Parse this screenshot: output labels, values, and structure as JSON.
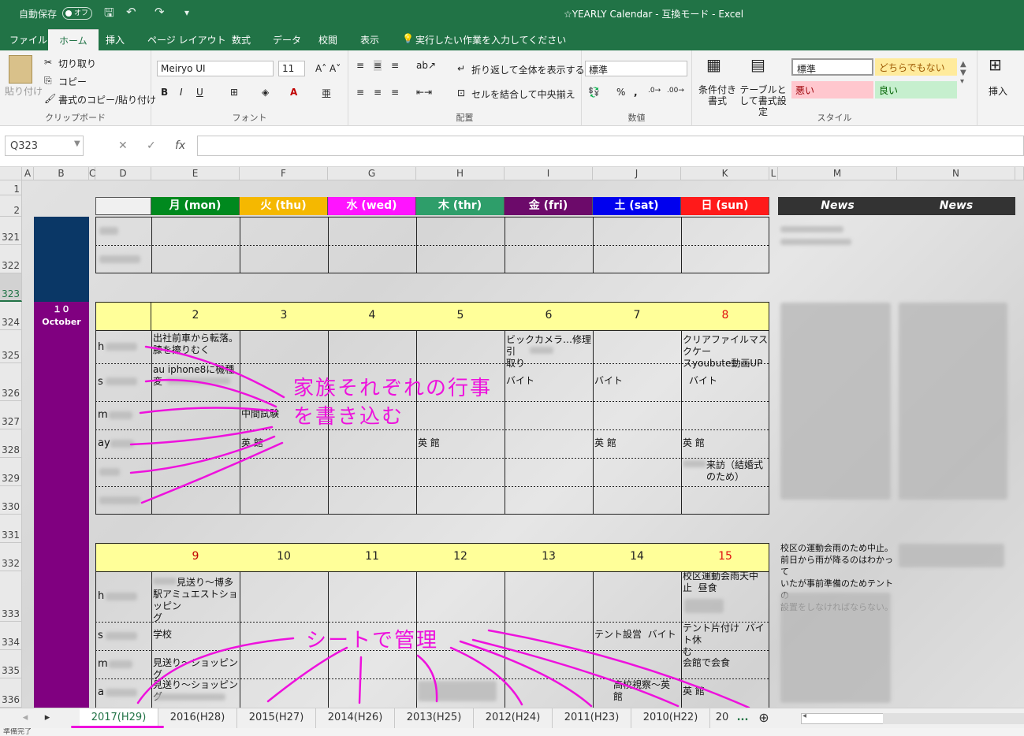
{
  "titlebar": {
    "autosave_label": "自動保存",
    "autosave_state": "オフ",
    "title": "☆YEARLY Calendar  -  互換モード  -  Excel"
  },
  "ribbon_tabs": [
    "ファイル",
    "ホーム",
    "挿入",
    "ページ レイアウト",
    "数式",
    "データ",
    "校閲",
    "表示"
  ],
  "tell_me": "実行したい作業を入力してください",
  "clipboard": {
    "paste": "貼り付け",
    "cut": "切り取り",
    "copy": "コピー",
    "format_painter": "書式のコピー/貼り付け",
    "label": "クリップボード"
  },
  "font": {
    "name": "Meiryo UI",
    "size": "11",
    "label": "フォント"
  },
  "alignment": {
    "wrap": "折り返して全体を表示する",
    "merge": "セルを結合して中央揃え",
    "label": "配置"
  },
  "number": {
    "format": "標準",
    "label": "数値"
  },
  "styles": {
    "conditional": "条件付き書式",
    "as_table": "テーブルとして書式設定",
    "normal": "標準",
    "neutral": "どちらでもない",
    "bad": "悪い",
    "good": "良い",
    "label": "スタイル"
  },
  "cells": {
    "insert": "挿入"
  },
  "formula_bar": {
    "name_box": "Q323",
    "fx": "fx"
  },
  "columns": [
    "A",
    "B",
    "C",
    "D",
    "E",
    "F",
    "G",
    "H",
    "I",
    "J",
    "K",
    "L",
    "M",
    "N"
  ],
  "weekdays": [
    {
      "label": "月 (mon)",
      "color": "#00891e"
    },
    {
      "label": "火 (thu)",
      "color": "#f5b800"
    },
    {
      "label": "水 (wed)",
      "color": "#ff14ff"
    },
    {
      "label": "木 (thr)",
      "color": "#2e9e6a"
    },
    {
      "label": "金 (fri)",
      "color": "#6c0a6a"
    },
    {
      "label": "土 (sat)",
      "color": "#0000ee"
    },
    {
      "label": "日 (sun)",
      "color": "#ff1a1a"
    }
  ],
  "news_header": "News",
  "rows": {
    "r1": "1",
    "r2": "2",
    "r321": "321",
    "r322": "322",
    "r323": "323",
    "r324": "324",
    "r325": "325",
    "r326": "326",
    "r327": "327",
    "r328": "328",
    "r329": "329",
    "r330": "330",
    "r331": "331",
    "r332": "332",
    "r333": "333",
    "r334": "334",
    "r335": "335",
    "r336": "336"
  },
  "month": {
    "num": "１０",
    "name": "October"
  },
  "week1": {
    "dates": [
      "2",
      "3",
      "4",
      "5",
      "6",
      "7",
      "8"
    ],
    "members": [
      "h",
      "s",
      "m",
      "ay",
      "",
      ""
    ],
    "e325": "出社前車から転落。\n膝を擦りむく",
    "e326": "au iphone8に機種\n変",
    "f327": "中間試験",
    "f328": "英 館",
    "h328": "英 館",
    "i325": "ビックカメラ…修理引\n取り",
    "i326": "バイト",
    "j326": "バイト",
    "j328": "英 館",
    "k325": "クリアファイルマスクケー\nスyoubute動画UP",
    "k326": "バイト",
    "k328": "英 館",
    "k329": "来訪（結婚式\nのため）"
  },
  "week2": {
    "dates": [
      "9",
      "10",
      "11",
      "12",
      "13",
      "14",
      "15"
    ],
    "members": [
      "h",
      "s",
      "m",
      "a"
    ],
    "e333": "見送り～博多\n駅アミュエストショッピン\nグ",
    "e334": "学校",
    "e335": "見送り～ショッピング",
    "e336": "見送り～ショッピング",
    "j334": "テント設営  バイト",
    "j336": "高校視察～英\n館",
    "k333": "校区運動会雨天中\n止  昼食",
    "k334": "テント片付け  バイト休\nむ",
    "k335": "会館で会食",
    "k336": "英 館",
    "m332": "校区の運動会雨のため中止。\n前日から雨が降るのはわかって\nいたが事前準備のためテントの\n設置をしなければならない。"
  },
  "annotations": {
    "a1": "家族それぞれの行事",
    "a2": "を書き込む",
    "a3": "シートで管理"
  },
  "sheet_tabs": [
    "2017(H29)",
    "2016(H28)",
    "2015(H27)",
    "2014(H26)",
    "2013(H25)",
    "2012(H24)",
    "2011(H23)",
    "2010(H22)",
    "20"
  ],
  "sheet_more": "...",
  "status": "準備完了"
}
